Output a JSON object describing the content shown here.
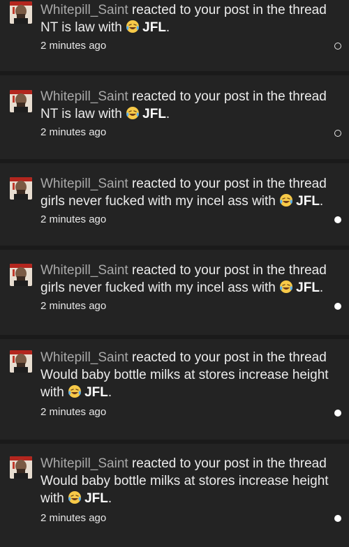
{
  "notifications": [
    {
      "user": "Whitepill_Saint",
      "action": " reacted to your post in the thread",
      "thread": "NT is law",
      "with_text": "with",
      "reaction": "JFL",
      "period": ".",
      "time": "2 minutes ago",
      "status": "read"
    },
    {
      "user": "Whitepill_Saint",
      "action": " reacted to your post in the thread",
      "thread": "NT is law",
      "with_text": "with",
      "reaction": "JFL",
      "period": ".",
      "time": "2 minutes ago",
      "status": "read"
    },
    {
      "user": "Whitepill_Saint",
      "action": " reacted to your post in the thread",
      "thread": "girls never fucked with my incel ass",
      "with_text": "with",
      "reaction": "JFL",
      "period": ".",
      "time": "2 minutes ago",
      "status": "unread"
    },
    {
      "user": "Whitepill_Saint",
      "action": " reacted to your post in the thread",
      "thread": "girls never fucked with my incel ass",
      "with_text": "with",
      "reaction": "JFL",
      "period": ".",
      "time": "2 minutes ago",
      "status": "unread"
    },
    {
      "user": "Whitepill_Saint",
      "action": " reacted to your post in the thread",
      "thread": "Would baby bottle milks at stores increase height",
      "with_text": "with",
      "reaction": "JFL",
      "period": ".",
      "time": "2 minutes ago",
      "status": "unread"
    },
    {
      "user": "Whitepill_Saint",
      "action": " reacted to your post in the thread",
      "thread": "Would baby bottle milks at stores increase height",
      "with_text": "with",
      "reaction": "JFL",
      "period": ".",
      "time": "2 minutes ago",
      "status": "unread"
    }
  ],
  "icons": {
    "avatar": "user-avatar",
    "reaction": "laughing-crying-emoji-icon",
    "read_dot": "read-indicator-icon",
    "unread_dot": "unread-indicator-icon"
  },
  "colors": {
    "background": "#1b1b1b",
    "card": "#232323",
    "username": "#a9a9a9",
    "text": "#ececec"
  }
}
